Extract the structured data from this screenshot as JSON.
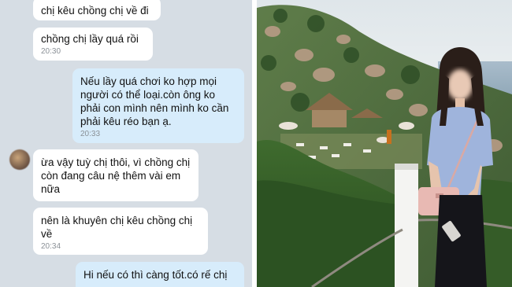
{
  "messages": [
    {
      "id": "m1",
      "side": "in",
      "text": "chị kêu chồng chị về đi",
      "time": ""
    },
    {
      "id": "m2",
      "side": "in",
      "text": "chồng chị lầy quá rồi",
      "time": "20:30"
    },
    {
      "id": "m3",
      "side": "out",
      "lines": [
        "Nếu lầy quá chơi ko hợp mọi",
        "người có thể loại.còn ông ko",
        "phải con mình nên mình ko cần",
        "phải kêu réo bạn ạ."
      ],
      "time": "20:33"
    },
    {
      "id": "m4",
      "side": "in",
      "lines": [
        "ừa vậy tuỳ chị thôi, vì chồng chị",
        "còn đang câu nệ thêm vài em",
        "nữa"
      ],
      "time": ""
    },
    {
      "id": "m5",
      "side": "in",
      "lines": [
        "nên là khuyên chị kêu chồng chị",
        "về"
      ],
      "time": "20:34"
    },
    {
      "id": "m6",
      "side": "out",
      "lines": [
        "Hi nếu có thì càng tốt.có rế chị"
      ],
      "time": ""
    }
  ],
  "colors": {
    "chat_background": "#d6dde4",
    "incoming_bubble": "#ffffff",
    "outgoing_bubble": "#d7ecfb",
    "timestamp": "#8a9096"
  },
  "photo": {
    "subject": "woman-standing-by-railing",
    "scene": "hillside-camp-by-sea",
    "face_blurred": true
  }
}
